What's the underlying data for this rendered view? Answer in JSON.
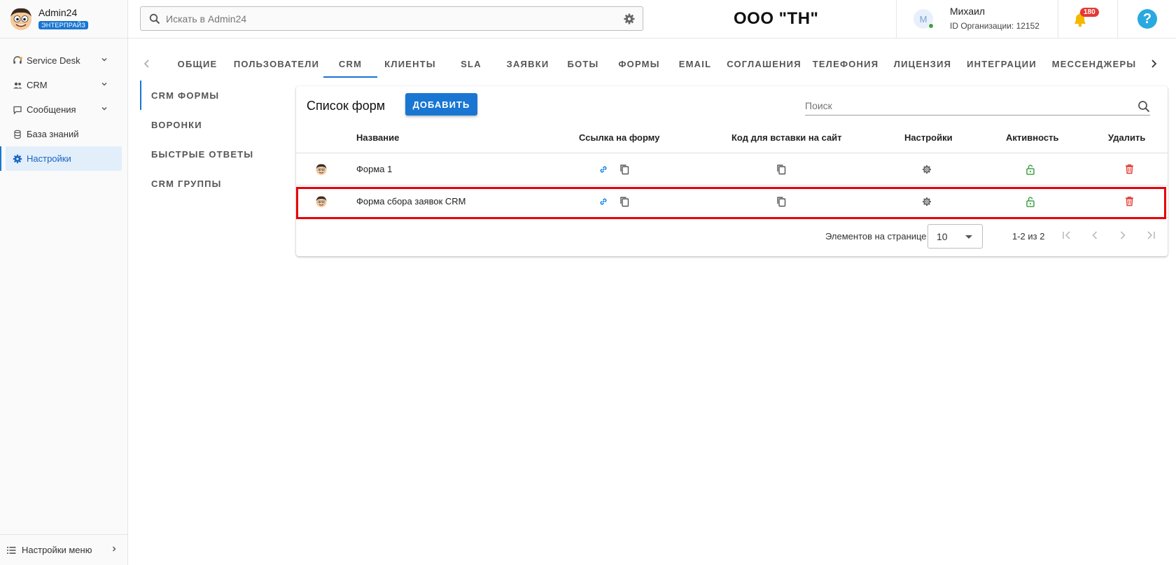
{
  "app": {
    "brand": "Admin24",
    "edition": "ЭНТЕРПРАЙЗ"
  },
  "sidebar": {
    "items": [
      {
        "label": "Service Desk",
        "icon": "headset-icon"
      },
      {
        "label": "CRM",
        "icon": "people-icon"
      },
      {
        "label": "Сообщения",
        "icon": "chat-icon"
      },
      {
        "label": "База знаний",
        "icon": "database-icon"
      },
      {
        "label": "Настройки",
        "icon": "gear-icon"
      }
    ],
    "footer": "Настройки меню"
  },
  "topbar": {
    "search_placeholder": "Искать в Admin24",
    "org_name": "ООО \"ТН\"",
    "user_initial": "М",
    "user_name": "Михаил",
    "org_id": "ID Организации: 12152",
    "notifications": "180",
    "help": "?"
  },
  "tabs": [
    "ОБЩИЕ",
    "ПОЛЬЗОВАТЕЛИ",
    "CRM",
    "КЛИЕНТЫ",
    "SLA",
    "ЗАЯВКИ",
    "БОТЫ",
    "ФОРМЫ",
    "EMAIL",
    "СОГЛАШЕНИЯ",
    "ТЕЛЕФОНИЯ",
    "ЛИЦЕНЗИЯ",
    "ИНТЕГРАЦИИ",
    "МЕССЕНДЖЕРЫ"
  ],
  "subnav": [
    "CRM ФОРМЫ",
    "ВОРОНКИ",
    "БЫСТРЫЕ ОТВЕТЫ",
    "CRM ГРУППЫ"
  ],
  "card": {
    "title": "Список форм",
    "add_label": "ДОБАВИТЬ",
    "search_placeholder": "Поиск",
    "columns": [
      "Название",
      "Ссылка на форму",
      "Код для вставки на сайт",
      "Настройки",
      "Активность",
      "Удалить"
    ],
    "rows": [
      {
        "name": "Форма 1"
      },
      {
        "name": "Форма сбора заявок CRM"
      }
    ],
    "pager": {
      "label": "Элементов на странице",
      "page_size": "10",
      "range": "1-2 из 2"
    }
  },
  "colors": {
    "accent": "#1976d2",
    "link_icon": "#1e88e5",
    "lock_icon": "#43a047",
    "delete_icon": "#e53935",
    "highlight": "#e8000b"
  }
}
